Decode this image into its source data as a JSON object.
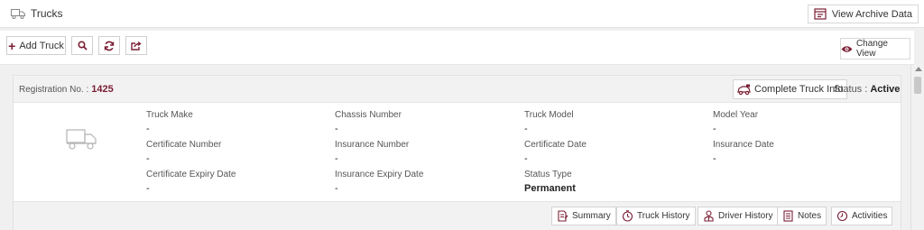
{
  "header": {
    "title": "Trucks",
    "archive_label": "View Archive Data"
  },
  "toolbar": {
    "add_label": "Add Truck",
    "change_view_label": "Change View"
  },
  "card": {
    "registration_label": "Registration No. :",
    "registration_value": "1425",
    "complete_info_label": "Complete Truck Info",
    "status_label": "Status :",
    "status_value": "Active",
    "fields": {
      "truck_make": {
        "label": "Truck Make",
        "value": "-"
      },
      "chassis_number": {
        "label": "Chassis Number",
        "value": "-"
      },
      "truck_model": {
        "label": "Truck Model",
        "value": "-"
      },
      "model_year": {
        "label": "Model Year",
        "value": "-"
      },
      "certificate_number": {
        "label": "Certificate Number",
        "value": "-"
      },
      "insurance_number": {
        "label": "Insurance Number",
        "value": "-"
      },
      "certificate_date": {
        "label": "Certificate Date",
        "value": "-"
      },
      "insurance_date": {
        "label": "Insurance Date",
        "value": "-"
      },
      "certificate_expiry_date": {
        "label": "Certificate Expiry Date",
        "value": "-"
      },
      "insurance_expiry_date": {
        "label": "Insurance Expiry Date",
        "value": "-"
      },
      "status_type": {
        "label": "Status Type",
        "value": "Permanent"
      }
    },
    "footer": {
      "summary": "Summary",
      "truck_history": "Truck History",
      "driver_history": "Driver History",
      "notes": "Notes",
      "activities": "Activities"
    }
  },
  "colors": {
    "accent": "#7b1f34",
    "header_bg": "#f2f2f2",
    "page_bg": "#f0f0f0"
  },
  "icons": [
    "truck-icon",
    "archive-icon",
    "plus-icon",
    "search-icon",
    "refresh-icon",
    "export-icon",
    "eye-icon",
    "truck-info-icon",
    "summary-icon",
    "history-icon",
    "driver-icon",
    "notes-icon",
    "activities-icon"
  ]
}
